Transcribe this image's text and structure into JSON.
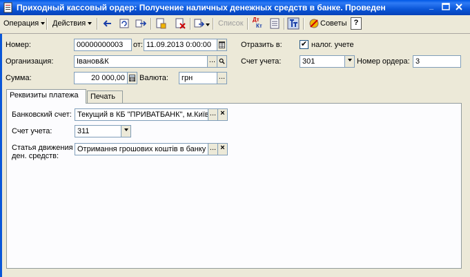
{
  "window": {
    "title": "Приходный кассовый ордер: Получение наличных денежных средств в банке. Проведен"
  },
  "toolbar": {
    "operation_label": "Операция",
    "actions_label": "Действия",
    "list_label": "Список",
    "dtkt_label_top": "Дт",
    "dtkt_label_bottom": "Кт",
    "tips_label": "Советы",
    "help_label": "?"
  },
  "header": {
    "number_label": "Номер:",
    "number_value": "00000000003",
    "from_label": "от:",
    "date_value": "11.09.2013  0:00:00",
    "reflect_label": "Отразить в:",
    "tax_label": "налог. учете",
    "tax_checked": "✔",
    "org_label": "Организация:",
    "org_value": "Іванов&К",
    "account_label": "Счет учета:",
    "account_value": "301",
    "order_number_label": "Номер ордера:",
    "order_number_value": "3",
    "sum_label": "Сумма:",
    "sum_value": "20 000,00",
    "currency_label": "Валюта:",
    "currency_value": "грн"
  },
  "tabs": {
    "payment_details": "Реквизиты платежа",
    "print": "Печать"
  },
  "payment": {
    "bank_account_label": "Банковский счет:",
    "bank_account_value": "Текущий в КБ \"ПРИВАТБАНК\", м.Київ",
    "account_label": "Счет учета:",
    "account_value": "311",
    "cash_flow_label_1": "Статья движения",
    "cash_flow_label_2": "ден. средств:",
    "cash_flow_value": "Отримання грошових коштів в банку"
  },
  "colors": {
    "titlebar": "#0a56d8",
    "form_bg": "#ece9d8",
    "field_border": "#7f9db9"
  }
}
